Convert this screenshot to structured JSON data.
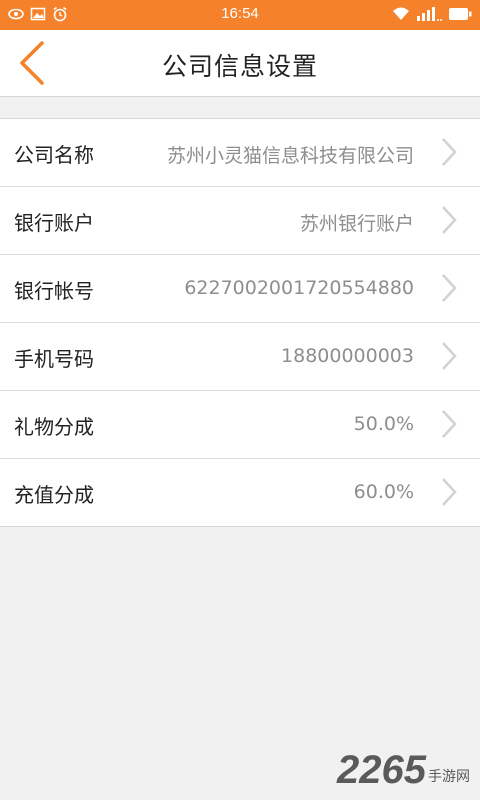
{
  "status_bar": {
    "time": "16:54",
    "left_icons": [
      "eye-icon",
      "image-icon",
      "alarm-icon"
    ],
    "right_icons": [
      "wifi-icon",
      "signal-icon",
      "battery-icon"
    ],
    "color": "#f5822a"
  },
  "header": {
    "title": "公司信息设置",
    "back_icon": "chevron-left-icon",
    "accent_color": "#f5822a"
  },
  "rows": [
    {
      "label": "公司名称",
      "value": "苏州小灵猫信息科技有限公司"
    },
    {
      "label": "银行账户",
      "value": "苏州银行账户"
    },
    {
      "label": "银行帐号",
      "value": "6227002001720554880"
    },
    {
      "label": "手机号码",
      "value": "18800000003"
    },
    {
      "label": "礼物分成",
      "value": "50.0%"
    },
    {
      "label": "充值分成",
      "value": "60.0%"
    }
  ],
  "watermark": {
    "big": "2265",
    "small": "手游网"
  }
}
